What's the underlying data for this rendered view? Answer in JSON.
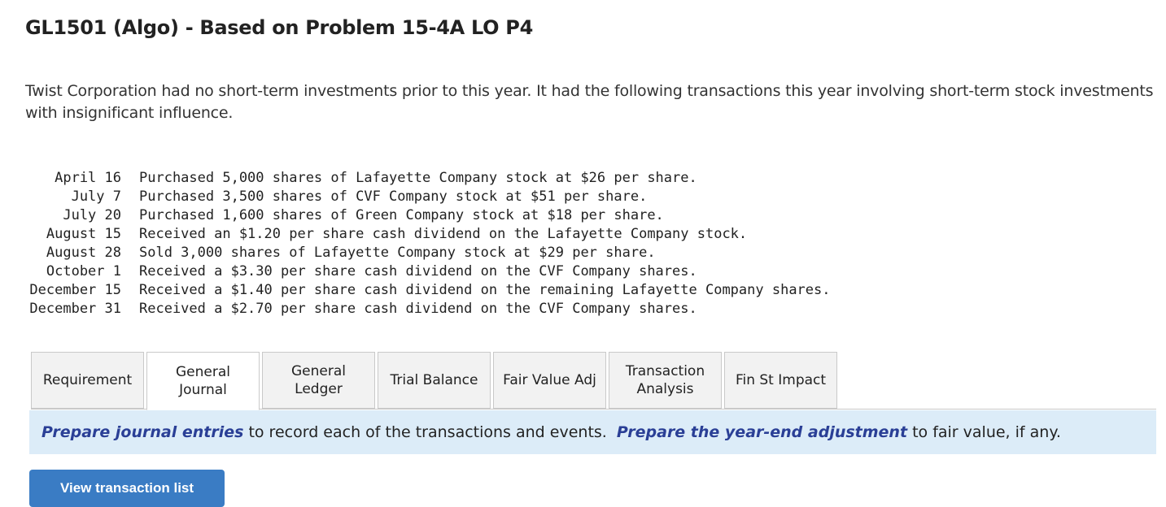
{
  "page_title": "GL1501 (Algo) - Based on Problem 15-4A LO P4",
  "intro_text": "Twist Corporation had no short-term investments prior to this year. It had the following transactions this year involving short-term stock investments with insignificant influence.",
  "transactions": [
    {
      "date": "April 16",
      "description": "Purchased 5,000 shares of Lafayette Company stock at $26 per share."
    },
    {
      "date": "July 7",
      "description": "Purchased 3,500 shares of CVF Company stock at $51 per share."
    },
    {
      "date": "July 20",
      "description": "Purchased 1,600 shares of Green Company stock at $18 per share."
    },
    {
      "date": "August 15",
      "description": "Received an $1.20 per share cash dividend on the Lafayette Company stock."
    },
    {
      "date": "August 28",
      "description": "Sold 3,000 shares of Lafayette Company stock at $29 per share."
    },
    {
      "date": "October 1",
      "description": "Received a $3.30 per share cash dividend on the CVF Company shares."
    },
    {
      "date": "December 15",
      "description": "Received a $1.40 per share cash dividend on the remaining Lafayette Company shares."
    },
    {
      "date": "December 31",
      "description": "Received a $2.70 per share cash dividend on the CVF Company shares."
    }
  ],
  "tabs": [
    {
      "line1": "Requirement",
      "line2": ""
    },
    {
      "line1": "General",
      "line2": "Journal"
    },
    {
      "line1": "General",
      "line2": "Ledger"
    },
    {
      "line1": "Trial Balance",
      "line2": ""
    },
    {
      "line1": "Fair Value Adj",
      "line2": ""
    },
    {
      "line1": "Transaction",
      "line2": "Analysis"
    },
    {
      "line1": "Fin St Impact",
      "line2": ""
    }
  ],
  "active_tab": "General Journal",
  "instruction": {
    "part1_emphasis": "Prepare journal entries",
    "part2": " to record each of the transactions and events.  ",
    "part3_emphasis": "Prepare the year-end adjustment",
    "part4": " to fair value, if any."
  },
  "view_transaction_list_label": "View transaction list",
  "colors": {
    "instruction_background": "#dcecf8",
    "emphasis_text": "#2a3f96",
    "button_background": "#3a7cc4",
    "tab_background": "#f2f2f2",
    "tab_border": "#c9c9c9"
  }
}
